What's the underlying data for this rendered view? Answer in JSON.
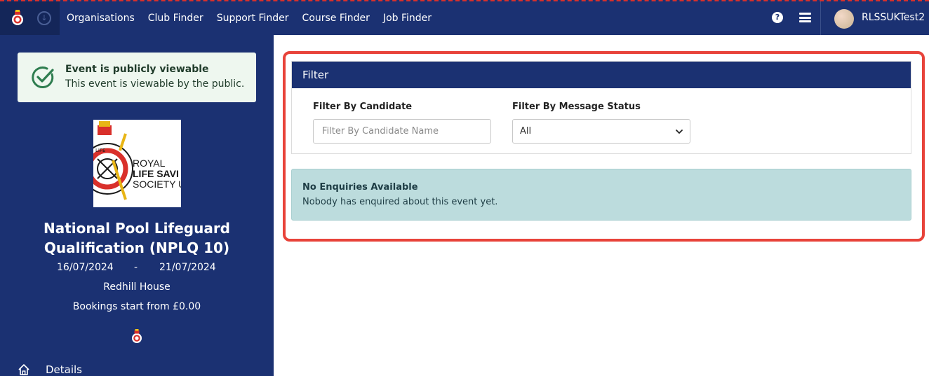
{
  "topbar": {
    "nav": [
      "Organisations",
      "Club Finder",
      "Support Finder",
      "Course Finder",
      "Job Finder"
    ],
    "help_symbol": "?",
    "username": "RLSSUKTest2"
  },
  "notice": {
    "title": "Event is publicly viewable",
    "text": "This event is viewable by the public."
  },
  "event": {
    "title": "National Pool Lifeguard Qualification (NPLQ 10)",
    "start_date": "16/07/2024",
    "date_separator": "-",
    "end_date": "21/07/2024",
    "venue": "Redhill House",
    "price": "Bookings start from £0.00"
  },
  "org_logo": {
    "line1": "ROYAL",
    "line2": "LIFE SAVI",
    "line3": "SOCIETY U"
  },
  "sidebar_nav": {
    "details_label": "Details"
  },
  "filter": {
    "header": "Filter",
    "candidate_label": "Filter By Candidate",
    "candidate_placeholder": "Filter By Candidate Name",
    "status_label": "Filter By Message Status",
    "status_selected": "All"
  },
  "info": {
    "title": "No Enquiries Available",
    "text": "Nobody has enquired about this event yet."
  },
  "colors": {
    "navy": "#1b3172",
    "highlight_red": "#e8433a",
    "info_teal": "#bcdcdd",
    "success_green": "#2e7d4f"
  },
  "icons": [
    "crest-logo-icon",
    "download-icon",
    "help-icon",
    "hamburger-menu-icon",
    "check-circle-icon",
    "home-icon",
    "chevron-down-icon"
  ]
}
